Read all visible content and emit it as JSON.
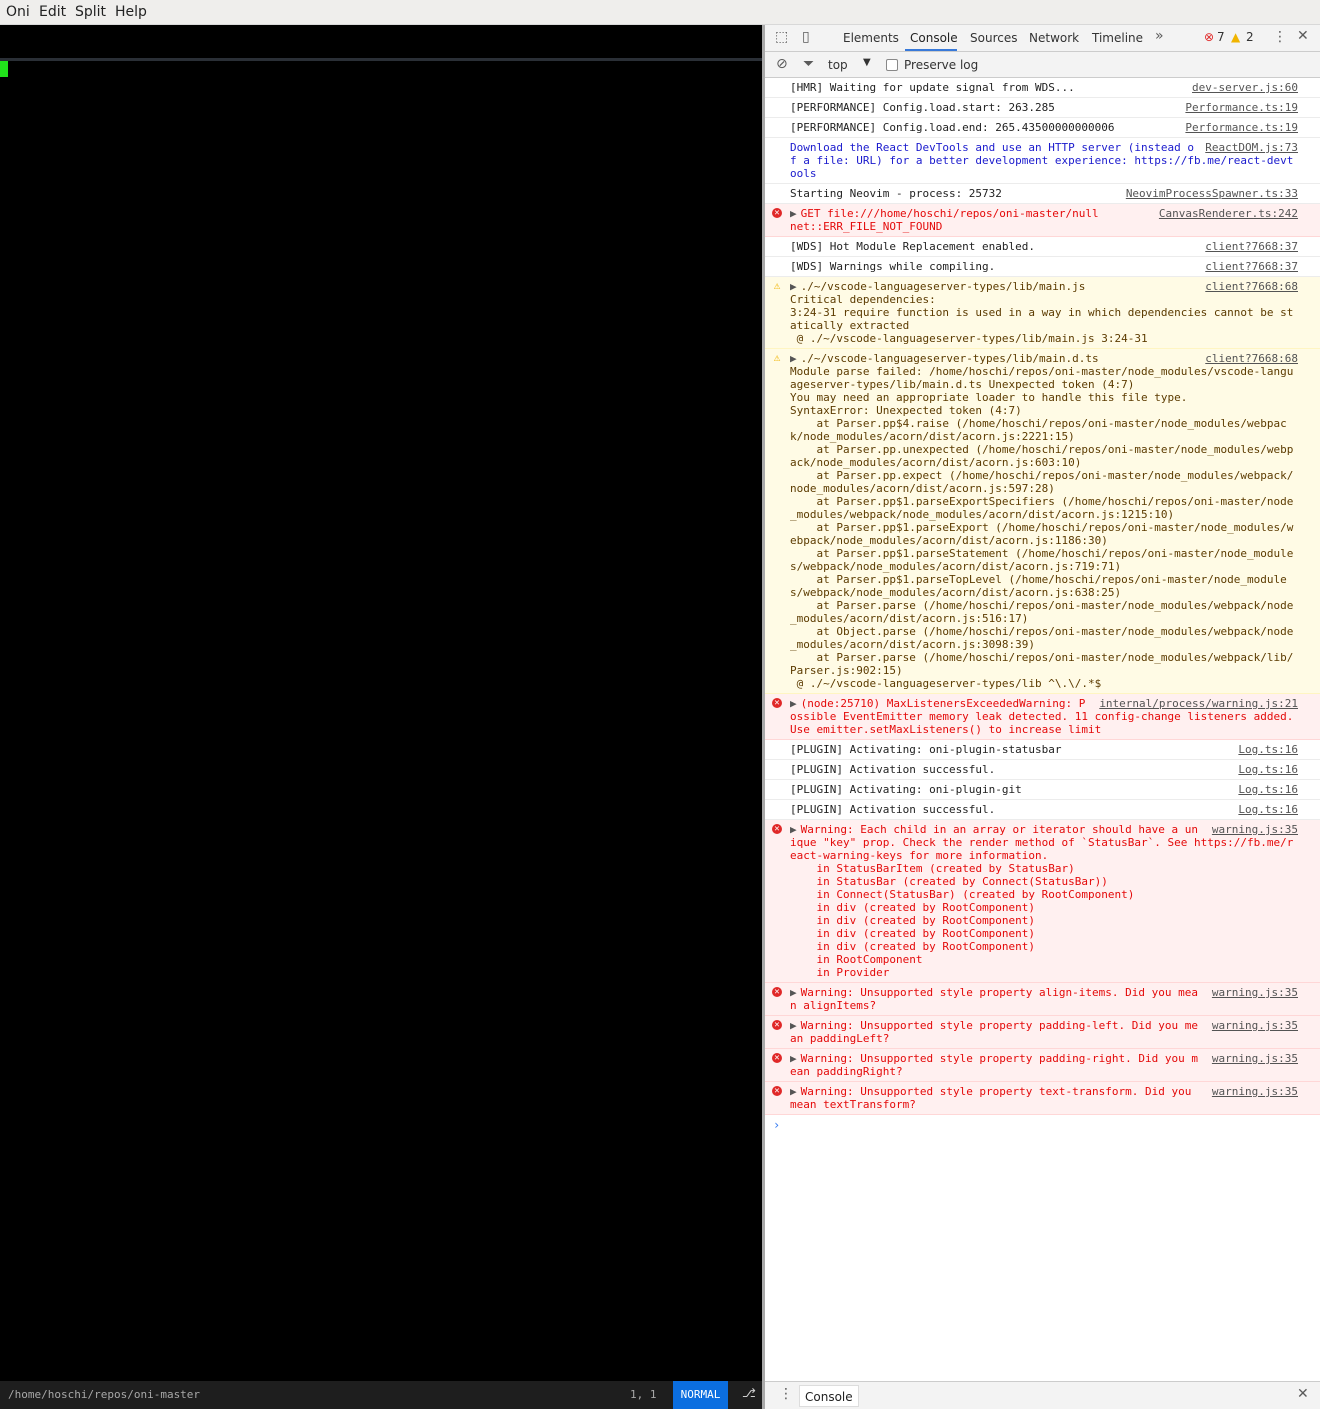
{
  "menubar": {
    "items": [
      "Oni",
      "Edit",
      "Split",
      "Help"
    ]
  },
  "editor": {
    "cursor_color": "#21e31b"
  },
  "statusbar": {
    "path": "/home/hoschi/repos/oni-master",
    "position": "1, 1",
    "mode": "NORMAL",
    "mode_color": "#0b6ee0"
  },
  "devtools": {
    "tabs": [
      "Elements",
      "Console",
      "Sources",
      "Network",
      "Timeline"
    ],
    "active_tab": "Console",
    "error_count": "7",
    "warning_count": "2",
    "context": "top",
    "preserve_log_label": "Preserve log",
    "drawer_tab": "Console",
    "messages": [
      {
        "level": "log",
        "text": "[HMR] Waiting for update signal from WDS...",
        "source": "dev-server.js:60"
      },
      {
        "level": "log",
        "text": "[PERFORMANCE] Config.load.start: 263.285",
        "source": "Performance.ts:19"
      },
      {
        "level": "log",
        "text": "[PERFORMANCE] Config.load.end: 265.43500000000006",
        "source": "Performance.ts:19"
      },
      {
        "level": "info",
        "text": "Download the React DevTools and use an HTTP server (instead of a file: URL) for a better development experience: https://fb.me/react-devtools",
        "source": "ReactDOM.js:73"
      },
      {
        "level": "log",
        "text": "Starting Neovim - process: 25732",
        "source": "NeovimProcessSpawner.ts:33"
      },
      {
        "level": "error",
        "expand": true,
        "text": "GET file:///home/hoschi/repos/oni-master/null\nnet::ERR_FILE_NOT_FOUND",
        "source": "CanvasRenderer.ts:242"
      },
      {
        "level": "log",
        "text": "[WDS] Hot Module Replacement enabled.",
        "source": "client?7668:37"
      },
      {
        "level": "log",
        "text": "[WDS] Warnings while compiling.",
        "source": "client?7668:37"
      },
      {
        "level": "warning",
        "expand": true,
        "text": "./~/vscode-languageserver-types/lib/main.js\nCritical dependencies:\n3:24-31 require function is used in a way in which dependencies cannot be statically extracted\n @ ./~/vscode-languageserver-types/lib/main.js 3:24-31",
        "source": "client?7668:68"
      },
      {
        "level": "warning",
        "expand": true,
        "text": "./~/vscode-languageserver-types/lib/main.d.ts\nModule parse failed: /home/hoschi/repos/oni-master/node_modules/vscode-languageserver-types/lib/main.d.ts Unexpected token (4:7)\nYou may need an appropriate loader to handle this file type.\nSyntaxError: Unexpected token (4:7)\n    at Parser.pp$4.raise (/home/hoschi/repos/oni-master/node_modules/webpack/node_modules/acorn/dist/acorn.js:2221:15)\n    at Parser.pp.unexpected (/home/hoschi/repos/oni-master/node_modules/webpack/node_modules/acorn/dist/acorn.js:603:10)\n    at Parser.pp.expect (/home/hoschi/repos/oni-master/node_modules/webpack/node_modules/acorn/dist/acorn.js:597:28)\n    at Parser.pp$1.parseExportSpecifiers (/home/hoschi/repos/oni-master/node_modules/webpack/node_modules/acorn/dist/acorn.js:1215:10)\n    at Parser.pp$1.parseExport (/home/hoschi/repos/oni-master/node_modules/webpack/node_modules/acorn/dist/acorn.js:1186:30)\n    at Parser.pp$1.parseStatement (/home/hoschi/repos/oni-master/node_modules/webpack/node_modules/acorn/dist/acorn.js:719:71)\n    at Parser.pp$1.parseTopLevel (/home/hoschi/repos/oni-master/node_modules/webpack/node_modules/acorn/dist/acorn.js:638:25)\n    at Parser.parse (/home/hoschi/repos/oni-master/node_modules/webpack/node_modules/acorn/dist/acorn.js:516:17)\n    at Object.parse (/home/hoschi/repos/oni-master/node_modules/webpack/node_modules/acorn/dist/acorn.js:3098:39)\n    at Parser.parse (/home/hoschi/repos/oni-master/node_modules/webpack/lib/Parser.js:902:15)\n @ ./~/vscode-languageserver-types/lib ^\\.\\/.*$",
        "source": "client?7668:68"
      },
      {
        "level": "error",
        "expand": true,
        "text": "(node:25710) MaxListenersExceededWarning: Possible EventEmitter memory leak detected. 11 config-change listeners added. Use emitter.setMaxListeners() to increase limit",
        "source": "internal/process/warning.js:21"
      },
      {
        "level": "log",
        "text": "[PLUGIN] Activating: oni-plugin-statusbar",
        "source": "Log.ts:16"
      },
      {
        "level": "log",
        "text": "[PLUGIN] Activation successful.",
        "source": "Log.ts:16"
      },
      {
        "level": "log",
        "text": "[PLUGIN] Activating: oni-plugin-git",
        "source": "Log.ts:16"
      },
      {
        "level": "log",
        "text": "[PLUGIN] Activation successful.",
        "source": "Log.ts:16"
      },
      {
        "level": "error",
        "expand": true,
        "text": "Warning: Each child in an array or iterator should have a unique \"key\" prop. Check the render method of `StatusBar`. See https://fb.me/react-warning-keys for more information.\n    in StatusBarItem (created by StatusBar)\n    in StatusBar (created by Connect(StatusBar))\n    in Connect(StatusBar) (created by RootComponent)\n    in div (created by RootComponent)\n    in div (created by RootComponent)\n    in div (created by RootComponent)\n    in div (created by RootComponent)\n    in RootComponent\n    in Provider",
        "source": "warning.js:35"
      },
      {
        "level": "error",
        "expand": true,
        "text": "Warning: Unsupported style property align-items. Did you mean alignItems?",
        "source": "warning.js:35"
      },
      {
        "level": "error",
        "expand": true,
        "text": "Warning: Unsupported style property padding-left. Did you mean paddingLeft?",
        "source": "warning.js:35"
      },
      {
        "level": "error",
        "expand": true,
        "text": "Warning: Unsupported style property padding-right. Did you mean paddingRight?",
        "source": "warning.js:35"
      },
      {
        "level": "error",
        "expand": true,
        "text": "Warning: Unsupported style property text-transform. Did you mean textTransform?",
        "source": "warning.js:35"
      }
    ]
  }
}
